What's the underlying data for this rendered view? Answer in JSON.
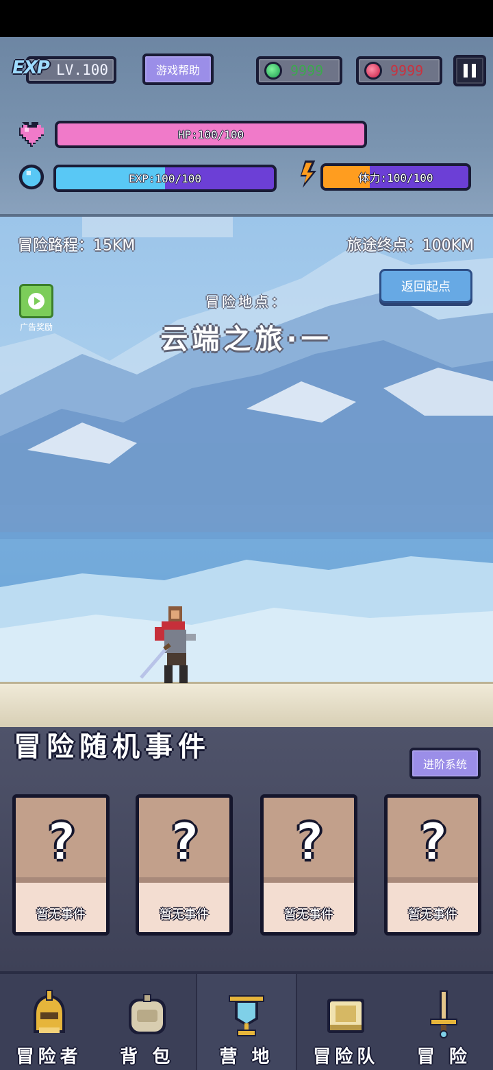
{
  "hud": {
    "level": "LV.100",
    "exp_logo": "EXP",
    "help_button": "游戏帮助",
    "green_currency": "9999",
    "red_currency": "9999",
    "hp_label": "HP:100/100",
    "hp_fraction": 1.0,
    "exp_label": "EXP:100/100",
    "exp_fraction": 0.5,
    "stamina_label": "体力:100/100",
    "stamina_fraction": 0.32
  },
  "scene": {
    "distance_traveled": "冒险路程：15KM",
    "journey_end": "旅途终点：100KM",
    "return_button": "返回起点",
    "ad_reward_label": "广告奖励",
    "location_label": "冒险地点：",
    "location_name": "云端之旅·一"
  },
  "events": {
    "title": "冒险随机事件",
    "advanced_button": "进阶系统",
    "cards": [
      {
        "symbol": "?",
        "text": "暂无事件"
      },
      {
        "symbol": "?",
        "text": "暂无事件"
      },
      {
        "symbol": "?",
        "text": "暂无事件"
      },
      {
        "symbol": "?",
        "text": "暂无事件"
      }
    ]
  },
  "nav": {
    "items": [
      {
        "label": "冒险者",
        "icon": "helmet-icon"
      },
      {
        "label": "背 包",
        "icon": "backpack-icon"
      },
      {
        "label": "营 地",
        "icon": "camp-banner-icon"
      },
      {
        "label": "冒险队",
        "icon": "guild-book-icon"
      },
      {
        "label": "冒 险",
        "icon": "sword-icon"
      }
    ],
    "active_index": 2
  },
  "colors": {
    "hp": "#f07ac9",
    "exp": "#59c8f5",
    "stamina": "#ff9d1f",
    "bar_track": "#6c3fd6",
    "button_purple": "#9b8ee8",
    "button_blue": "#67a9e4"
  }
}
